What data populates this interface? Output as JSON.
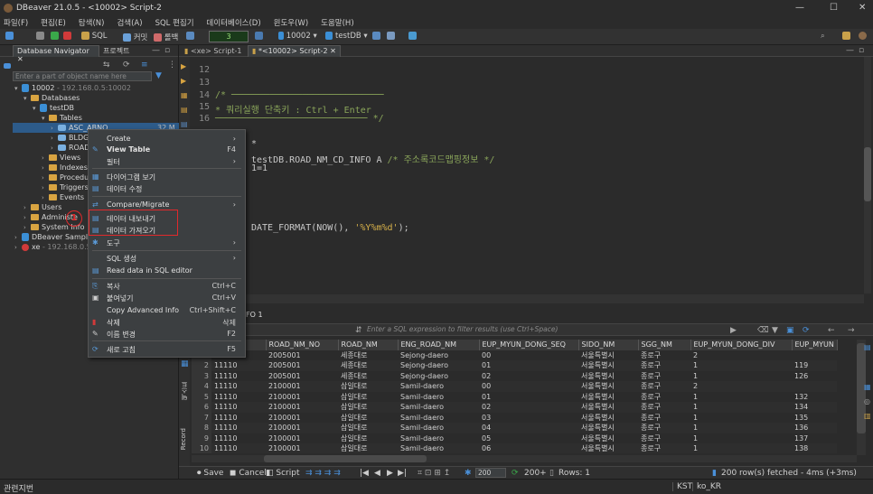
{
  "title": "DBeaver 21.0.5 - <10002> Script-2",
  "menu": [
    "파일(F)",
    "편집(E)",
    "탐색(N)",
    "검색(A)",
    "SQL 편집기",
    "데이터베이스(D)",
    "윈도우(W)",
    "도움말(H)"
  ],
  "toolbar": {
    "sql": "SQL",
    "commit": "커밋",
    "rollback": "롤백",
    "counter": "3",
    "conn": "10002",
    "db": "testDB"
  },
  "nav": {
    "tab1": "Database Navigator",
    "tab2": "프로젝트",
    "filter_placeholder": "Enter a part of object name here",
    "conn1": "10002",
    "conn1_host": "- 192.168.0.5:10002",
    "databases": "Databases",
    "testdb": "testDB",
    "tables": "Tables",
    "t1": "ASC_ABNO",
    "t1_size": "32 M",
    "t2": "BLDG",
    "t3": "ROAD",
    "views": "Views",
    "indexes": "Indexes",
    "procedures": "Procedu",
    "triggers": "Triggers",
    "events": "Events",
    "users": "Users",
    "administer": "Administe",
    "system": "System Info",
    "sample": "DBeaver Sample",
    "xe": "xe",
    "xe_host": "- 192.168.0.5"
  },
  "editor": {
    "tab1": "<xe> Script-1",
    "tab2": "*<10002> Script-2",
    "lines": [
      {
        "n": "12",
        "c": ""
      },
      {
        "n": "13",
        "c": ""
      },
      {
        "n": "14",
        "c": "/* ────────────────────────────"
      },
      {
        "n": "15",
        "c": " * 쿼리실행 단축키 : Ctrl + Enter"
      },
      {
        "n": "16",
        "c": " ──────────────────────────── */"
      }
    ],
    "l1": "*",
    "l2": "testDB.ROAD_NM_CD_INFO A",
    "l2c": "/* 주소록코드맵핑정보 */",
    "l3": "1=1",
    "l4a": "DATE_FORMAT(NOW(), ",
    "l4b": "'%Y%m%d'",
    "l4c": ");"
  },
  "results": {
    "tab": "FO 1",
    "filter_placeholder": "Enter a SQL expression to filter results (use Ctrl+Space)",
    "columns": [
      "ROAD_NM_NO",
      "ROAD_NM",
      "ENG_ROAD_NM",
      "EUP_MYUN_DONG_SEQ",
      "SIDO_NM",
      "SGG_NM",
      "EUP_MYUN_DONG_DIV",
      "EUP_MYUN"
    ],
    "rows": [
      [
        "1",
        "11110",
        "2005001",
        "세종대로",
        "Sejong-daero",
        "00",
        "서울특별시",
        "종로구",
        "2",
        ""
      ],
      [
        "2",
        "11110",
        "2005001",
        "세종대로",
        "Sejong-daero",
        "01",
        "서울특별시",
        "종로구",
        "1",
        "119"
      ],
      [
        "3",
        "11110",
        "2005001",
        "세종대로",
        "Sejong-daero",
        "02",
        "서울특별시",
        "종로구",
        "1",
        "126"
      ],
      [
        "4",
        "11110",
        "2100001",
        "삼일대로",
        "Samil-daero",
        "00",
        "서울특별시",
        "종로구",
        "2",
        ""
      ],
      [
        "5",
        "11110",
        "2100001",
        "삼일대로",
        "Samil-daero",
        "01",
        "서울특별시",
        "종로구",
        "1",
        "132"
      ],
      [
        "6",
        "11110",
        "2100001",
        "삼일대로",
        "Samil-daero",
        "02",
        "서울특별시",
        "종로구",
        "1",
        "134"
      ],
      [
        "7",
        "11110",
        "2100001",
        "삼일대로",
        "Samil-daero",
        "03",
        "서울특별시",
        "종로구",
        "1",
        "135"
      ],
      [
        "8",
        "11110",
        "2100001",
        "삼일대로",
        "Samil-daero",
        "04",
        "서울특별시",
        "종로구",
        "1",
        "136"
      ],
      [
        "9",
        "11110",
        "2100001",
        "삼일대로",
        "Samil-daero",
        "05",
        "서울특별시",
        "종로구",
        "1",
        "137"
      ],
      [
        "10",
        "11110",
        "2100001",
        "삼일대로",
        "Samil-daero",
        "06",
        "서울특별시",
        "종로구",
        "1",
        "138"
      ]
    ],
    "save": "Save",
    "cancel": "Cancel",
    "script": "Script",
    "fetch_size": "200",
    "count": "200+",
    "rows_label": "Rows: 1",
    "fetched": "200 row(s) fetched - 4ms (+3ms)",
    "side_record": "Record",
    "side_text": "텍스트"
  },
  "menu_ctx": [
    {
      "label": "Create",
      "shortcut": "",
      "sub": true
    },
    {
      "label": "View Table",
      "shortcut": "F4",
      "bold": true
    },
    {
      "label": "필터",
      "shortcut": "",
      "sub": true
    },
    {
      "label": "다이어그램 보기",
      "shortcut": ""
    },
    {
      "label": "데이터 수정",
      "shortcut": ""
    },
    {
      "label": "Compare/Migrate",
      "shortcut": "",
      "sub": true
    },
    {
      "label": "데이터 내보내기",
      "shortcut": ""
    },
    {
      "label": "데이터 가져오기",
      "shortcut": ""
    },
    {
      "label": "도구",
      "shortcut": "",
      "sub": true
    },
    {
      "label": "SQL 생성",
      "shortcut": "",
      "sub": true
    },
    {
      "label": "Read data in SQL editor",
      "shortcut": ""
    },
    {
      "label": "복사",
      "shortcut": "Ctrl+C"
    },
    {
      "label": "붙여넣기",
      "shortcut": "Ctrl+V"
    },
    {
      "label": "Copy Advanced Info",
      "shortcut": "Ctrl+Shift+C"
    },
    {
      "label": "삭제",
      "shortcut": "삭제"
    },
    {
      "label": "이름 변경",
      "shortcut": "F2"
    },
    {
      "label": "새로 고침",
      "shortcut": "F5"
    }
  ],
  "badge": "1",
  "status": {
    "left": "관련지번",
    "tz": "KST",
    "locale": "ko_KR"
  },
  "colors": {
    "highlight": "#e0292c",
    "selection": "#2d5b8a"
  }
}
